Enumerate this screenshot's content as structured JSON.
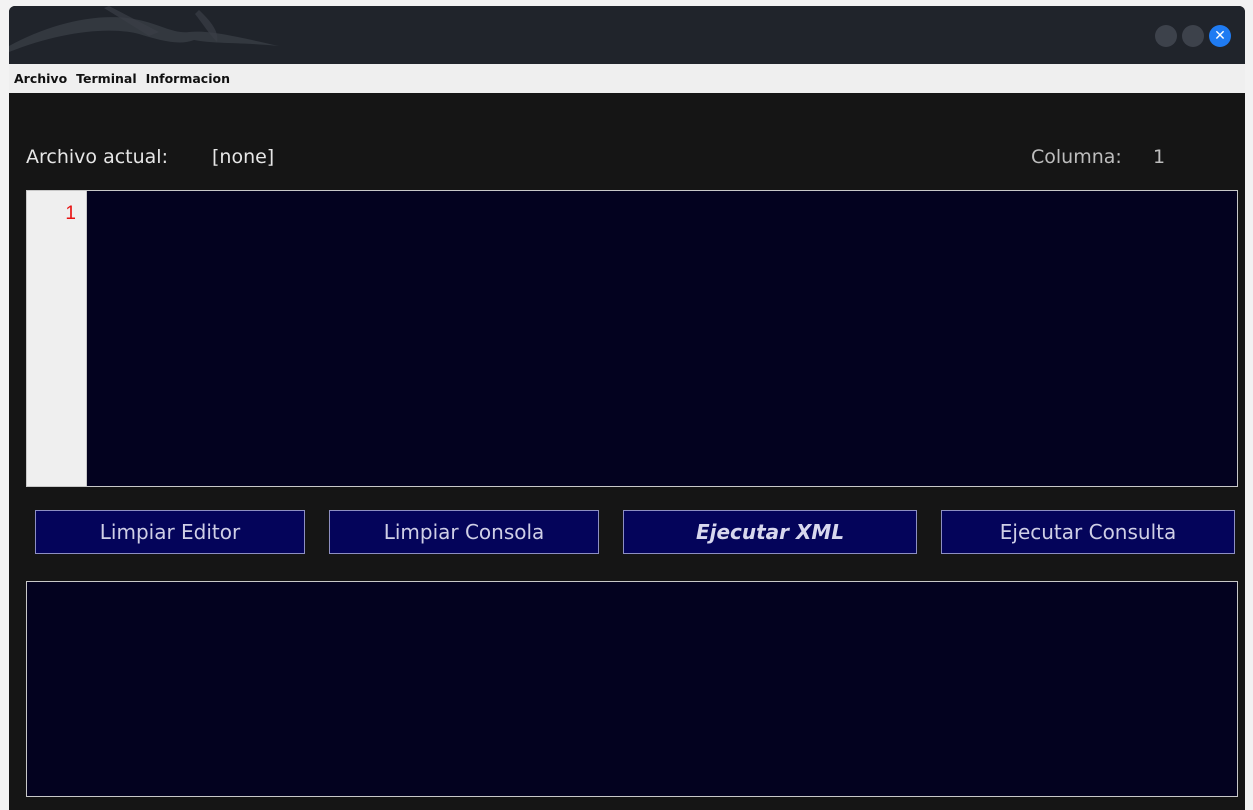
{
  "window": {
    "close_glyph": "✕"
  },
  "menu": {
    "items": [
      {
        "label": "Archivo"
      },
      {
        "label": "Terminal"
      },
      {
        "label": "Informacion"
      }
    ]
  },
  "status": {
    "file_label": "Archivo actual:",
    "file_value": "[none]",
    "column_label": "Columna:",
    "column_value": "1"
  },
  "editor": {
    "line_numbers": [
      "1"
    ],
    "content": ""
  },
  "buttons": {
    "clear_editor": "Limpiar Editor",
    "clear_console": "Limpiar Consola",
    "run_xml": "Ejecutar XML",
    "run_query": "Ejecutar Consulta"
  },
  "console": {
    "content": ""
  },
  "colors": {
    "editor_bg": "#03021f",
    "button_bg": "#04045a",
    "line_number": "#e81313",
    "close_button": "#1f7bf2"
  }
}
